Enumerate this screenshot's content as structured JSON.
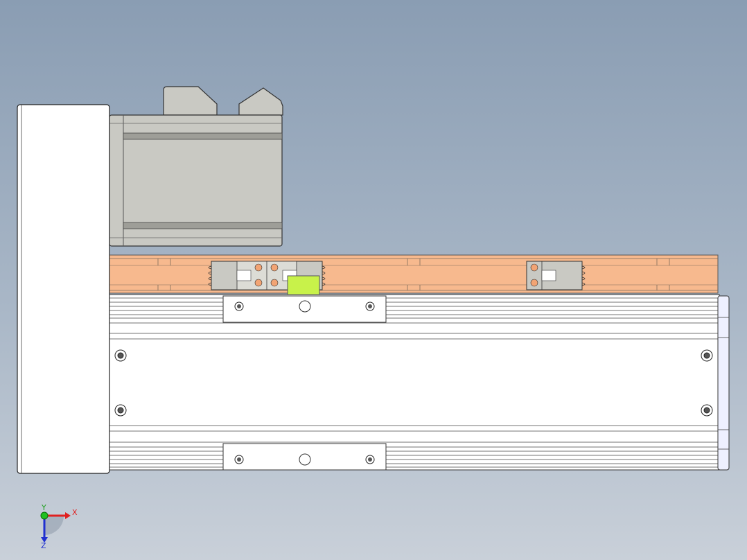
{
  "viewport": {
    "background_top": "#8a9db3",
    "background_bottom": "#c9d0d9"
  },
  "model": {
    "colors": {
      "motor_body": "#c9c9c3",
      "end_plate": "#ffffff",
      "cover_strip": "#f7b98e",
      "carriage_highlight": "#c8f24a",
      "outline": "#333333"
    }
  },
  "triad": {
    "x_label": "X",
    "y_label": "Y",
    "z_label": "Z",
    "x_color": "#e02020",
    "y_color": "#20c020",
    "z_color": "#2030d0"
  }
}
